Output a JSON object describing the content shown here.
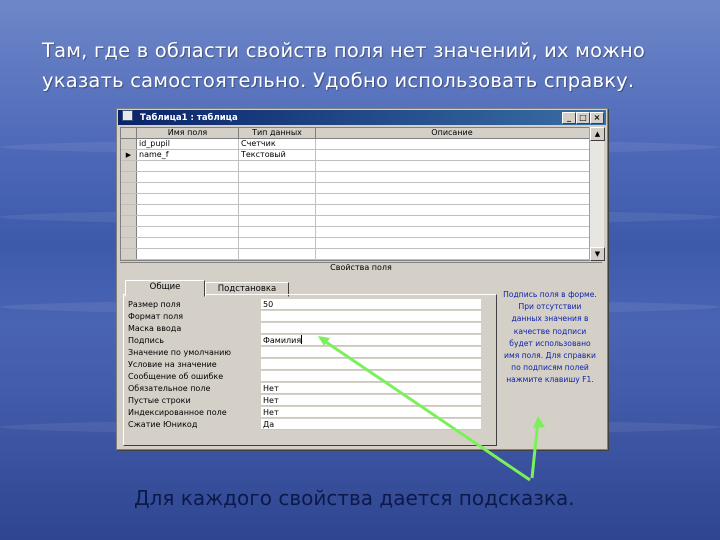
{
  "slide": {
    "title": "Там, где в области свойств поля нет значений, их можно указать самостоятельно. Удобно использовать справку.",
    "caption": "Для каждого свойства дается подсказка."
  },
  "window": {
    "title": "Таблица1 : таблица",
    "buttons": {
      "minimize": "_",
      "maximize": "□",
      "close": "×"
    }
  },
  "grid": {
    "headers": [
      "Имя поля",
      "Тип данных",
      "Описание"
    ],
    "rows": [
      {
        "selector": "",
        "name": "id_pupil",
        "type": "Счетчик",
        "description": ""
      },
      {
        "selector": "▶",
        "name": "name_f",
        "type": "Текстовый",
        "description": ""
      }
    ]
  },
  "scrollbar": {
    "up": "▲",
    "down": "▼"
  },
  "properties": {
    "section_label": "Свойства поля",
    "tabs": [
      "Общие",
      "Подстановка"
    ],
    "rows": [
      {
        "label": "Размер поля",
        "value": "50"
      },
      {
        "label": "Формат поля",
        "value": ""
      },
      {
        "label": "Маска ввода",
        "value": ""
      },
      {
        "label": "Подпись",
        "value": "Фамилия"
      },
      {
        "label": "Значение по умолчанию",
        "value": ""
      },
      {
        "label": "Условие на значение",
        "value": ""
      },
      {
        "label": "Сообщение об ошибке",
        "value": ""
      },
      {
        "label": "Обязательное поле",
        "value": "Нет"
      },
      {
        "label": "Пустые строки",
        "value": "Нет"
      },
      {
        "label": "Индексированное поле",
        "value": "Нет"
      },
      {
        "label": "Сжатие Юникод",
        "value": "Да"
      }
    ],
    "help_text": "Подпись поля в форме. При отсутствии данных значения в качестве подписи будет использовано имя поля. Для справки по подписям полей нажмите клавишу F1."
  },
  "colors": {
    "titlebar_start": "#0a246a",
    "titlebar_end": "#3a6ea5",
    "help_text": "#0a1fa8",
    "arrow": "#7cf05a"
  }
}
